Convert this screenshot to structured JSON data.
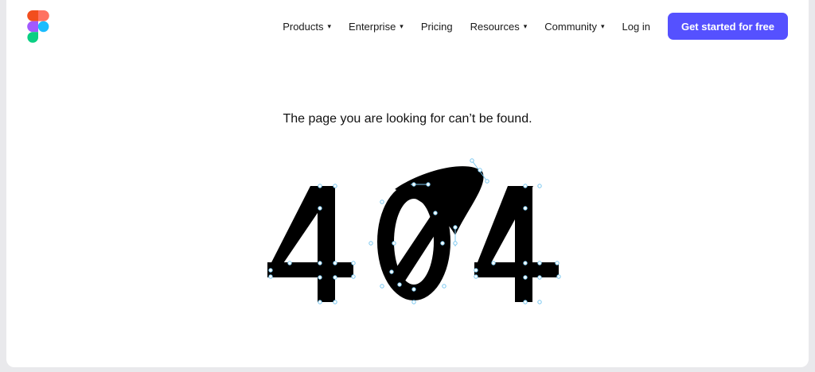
{
  "brand": {
    "logo_icon": "figma-logo-icon"
  },
  "nav": {
    "items": [
      {
        "label": "Products",
        "has_dropdown": true
      },
      {
        "label": "Enterprise",
        "has_dropdown": true
      },
      {
        "label": "Pricing",
        "has_dropdown": false
      },
      {
        "label": "Resources",
        "has_dropdown": true
      },
      {
        "label": "Community",
        "has_dropdown": true
      },
      {
        "label": "Log in",
        "has_dropdown": false
      }
    ],
    "caret": "▾",
    "cta_label": "Get started for free"
  },
  "main": {
    "message": "The page you are looking for can’t be found.",
    "error_art": {
      "digits": [
        "4",
        "0",
        "4"
      ],
      "icon": "vector-edit-404-illustration"
    }
  },
  "colors": {
    "cta_background": "#5551ff",
    "cta_text": "#ffffff",
    "text": "#1a1a1a",
    "anchor_points": "#7cc8f0",
    "logo": [
      "#f24e1e",
      "#ff7262",
      "#a259ff",
      "#1abcfe",
      "#0acf83"
    ]
  }
}
